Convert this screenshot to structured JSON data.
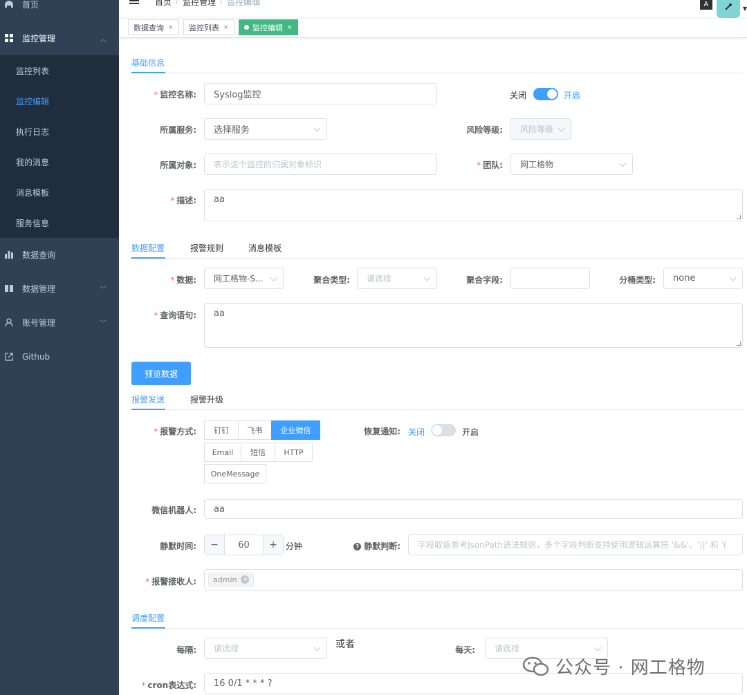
{
  "sidebar": {
    "home": "首页",
    "monitor_mgmt": "监控管理",
    "monitor_sub": [
      "监控列表",
      "监控编辑",
      "执行日志",
      "我的消息",
      "消息模板",
      "服务信息"
    ],
    "data_query": "数据查询",
    "data_mgmt": "数据管理",
    "account_mgmt": "账号管理",
    "github": "Github"
  },
  "breadcrumb": {
    "home": "首页",
    "sep": "/",
    "mid": "监控管理",
    "current": "监控编辑"
  },
  "topbar": {
    "lang": "A"
  },
  "tags": {
    "t1": "数据查询",
    "t2": "监控列表",
    "t3": "监控编辑",
    "close": "×"
  },
  "sections": {
    "basic": "基础信息",
    "data_config": "数据配置",
    "alert_rules": "报警规则",
    "msg_template": "消息模板",
    "alert_send": "报警发送",
    "alert_escalate": "报警升级",
    "schedule": "调度配置"
  },
  "basic": {
    "name_label": "监控名称:",
    "name_value": "Syslog监控",
    "switch_off": "关闭",
    "switch_on": "开启",
    "service_label": "所属服务:",
    "service_value": "选择服务",
    "risk_label": "风险等级:",
    "risk_value": "风险等级",
    "object_label": "所属对象:",
    "object_placeholder": "表示这个监控的归属对象标识",
    "team_label": "团队:",
    "team_value": "网工格物",
    "desc_label": "描述:",
    "desc_value": "aa"
  },
  "data_cfg": {
    "data_label": "数据:",
    "data_value": "网工格物-S...",
    "agg_type_label": "聚合类型:",
    "agg_type_placeholder": "请选择",
    "agg_field_label": "聚合字段:",
    "agg_field_value": "",
    "bucket_label": "分桶类型:",
    "bucket_value": "none",
    "query_label": "查询语句:",
    "query_value": "aa",
    "preview_button": "预览数据"
  },
  "send": {
    "method_label": "报警方式:",
    "methods": [
      "钉钉",
      "飞书",
      "企业微信",
      "Email",
      "短信",
      "HTTP",
      "OneMessage"
    ],
    "recover_label": "恢复通知:",
    "recover_off": "关闭",
    "recover_on": "开启",
    "bot_label": "微信机器人:",
    "bot_value": "aa",
    "silent_label": "静默时间:",
    "silent_value": "60",
    "silent_minus": "−",
    "silent_plus": "+",
    "silent_unit": "分钟",
    "silent_judge_label": "静默判断:",
    "silent_judge_placeholder": "字段取值参考JsonPath语法规则，多个字段判断支持使用逻辑运算符 '&&'、'||' 和 '(",
    "receiver_label": "报警接收人:",
    "receiver_chip": "admin"
  },
  "schedule": {
    "every_label": "每隔:",
    "every_placeholder": "请选择",
    "or_text": "或者",
    "daily_label": "每天:",
    "daily_placeholder": "请选择",
    "cron_label": "cron表达式:",
    "cron_value": "16 0/1 * * * ?"
  },
  "watermark": "公众号 · 网工格物",
  "colors": {
    "sidebar_bg": "#304156",
    "submenu_bg": "#1f2d3d",
    "accent": "#409eff",
    "tag_active": "#42b983"
  }
}
